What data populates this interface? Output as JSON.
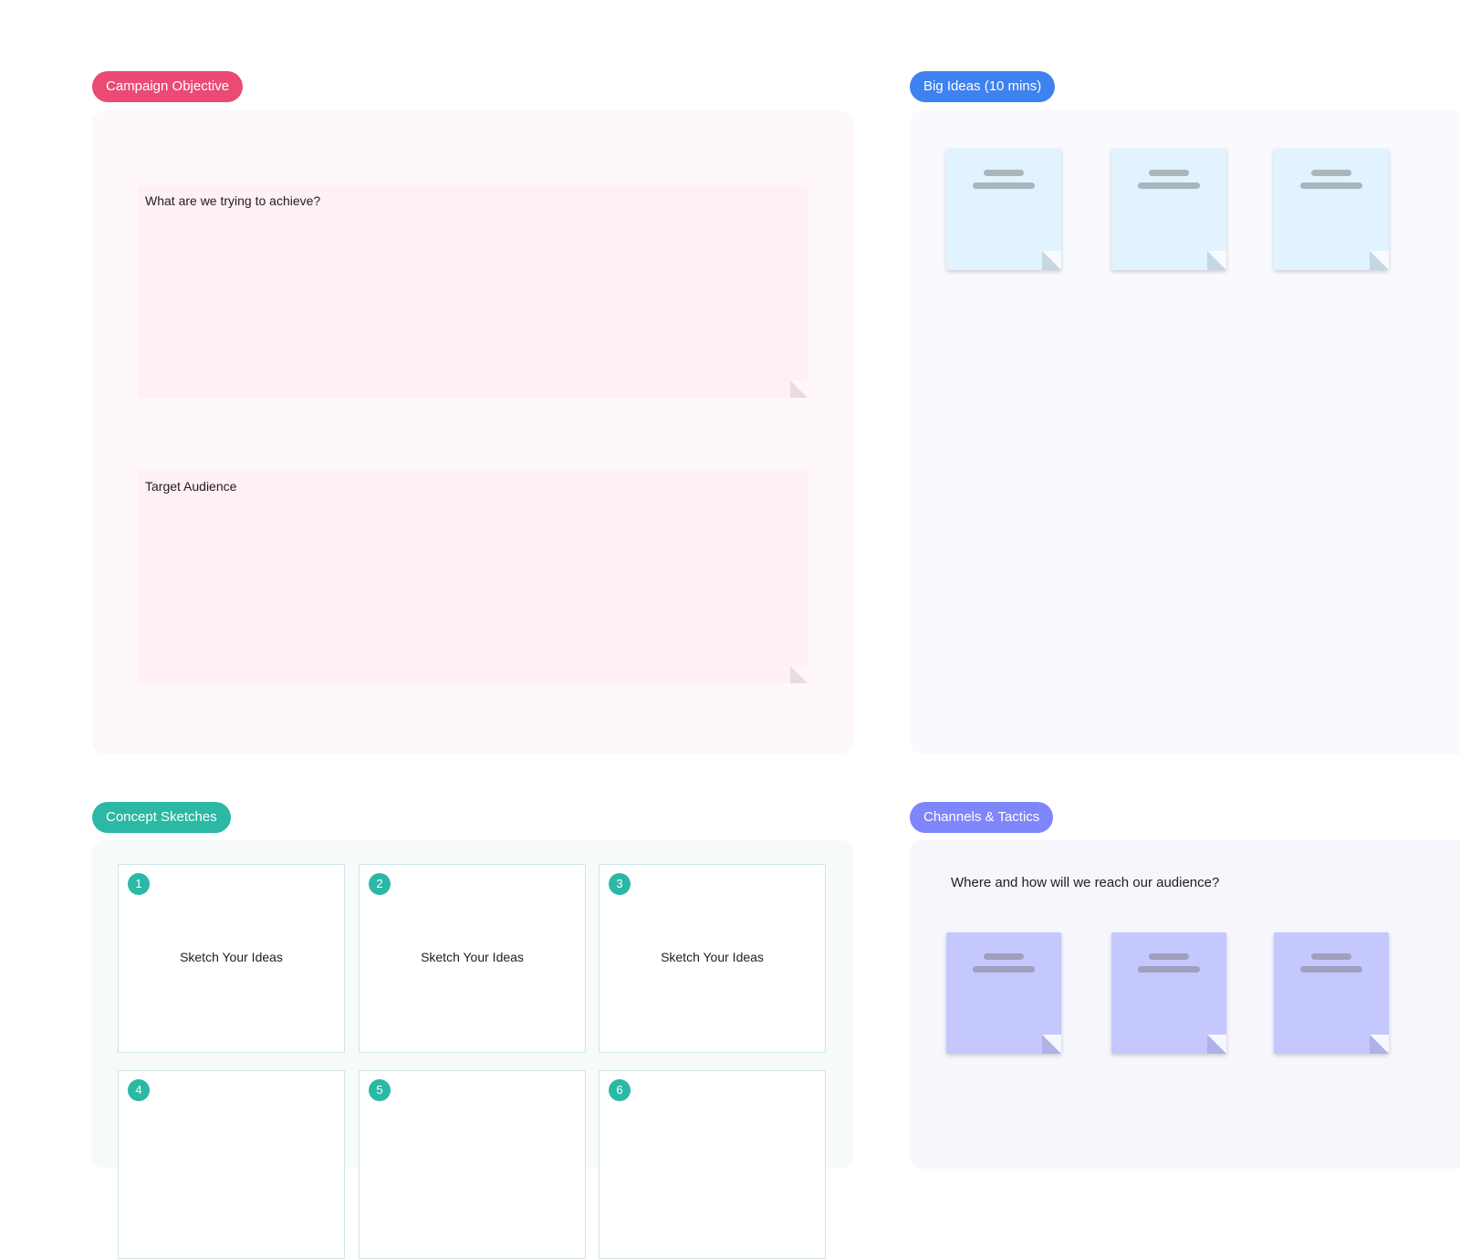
{
  "colors": {
    "objective": "#ea4a74",
    "big_ideas": "#3d82ee",
    "concept": "#2bb8a5",
    "channels": "#7f85fa"
  },
  "sections": {
    "objective": {
      "label": "Campaign Objective",
      "notes": [
        "What are we trying to achieve?",
        "Target Audience"
      ]
    },
    "big_ideas": {
      "label": "Big Ideas (10 mins)"
    },
    "concept": {
      "label": "Concept Sketches",
      "cards": [
        {
          "number": "1",
          "text": "Sketch Your Ideas"
        },
        {
          "number": "2",
          "text": "Sketch Your Ideas"
        },
        {
          "number": "3",
          "text": "Sketch Your Ideas"
        },
        {
          "number": "4"
        },
        {
          "number": "5"
        },
        {
          "number": "6"
        }
      ]
    },
    "channels": {
      "label": "Channels & Tactics",
      "question": "Where and how will we reach our audience?"
    }
  }
}
